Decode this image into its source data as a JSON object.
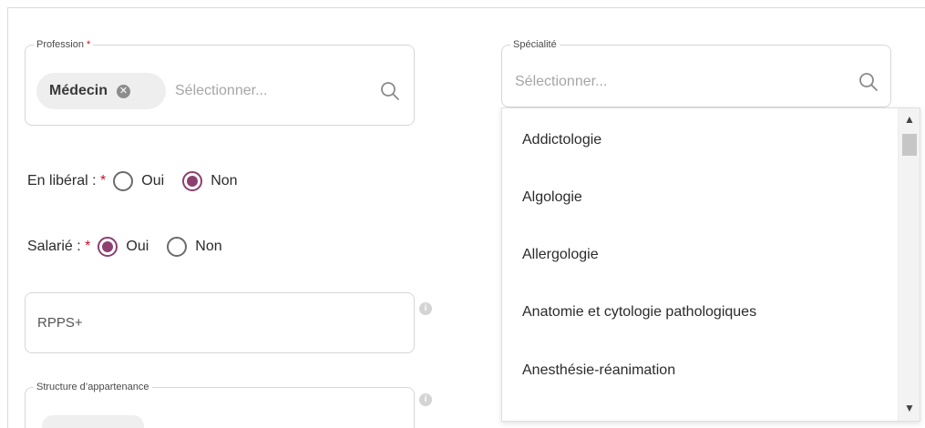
{
  "profession": {
    "legend": "Profession",
    "required_mark": "*",
    "selected_chip": "Médecin",
    "placeholder": "Sélectionner..."
  },
  "specialite": {
    "legend": "Spécialité",
    "placeholder": "Sélectionner...",
    "options": [
      "Addictologie",
      "Algologie",
      "Allergologie",
      "Anatomie et cytologie pathologiques",
      "Anesthésie-réanimation"
    ]
  },
  "liberal": {
    "label": "En libéral :",
    "required_mark": "*",
    "options": [
      "Oui",
      "Non"
    ],
    "selected": "Non"
  },
  "salarie": {
    "label": "Salarié :",
    "required_mark": "*",
    "options": [
      "Oui",
      "Non"
    ],
    "selected": "Oui"
  },
  "rpps": {
    "placeholder": "RPPS+"
  },
  "structure": {
    "legend": "Structure d’appartenance"
  },
  "colors": {
    "accent": "#8d3f6f",
    "required": "#c8102e",
    "border": "#d7d7d7",
    "placeholder": "#a6a6a6"
  },
  "icons": {
    "search": "search-icon",
    "chip_remove": "close-circle-icon",
    "info": "info-icon",
    "scroll_up": "chevron-up-icon",
    "scroll_down": "chevron-down-icon"
  }
}
